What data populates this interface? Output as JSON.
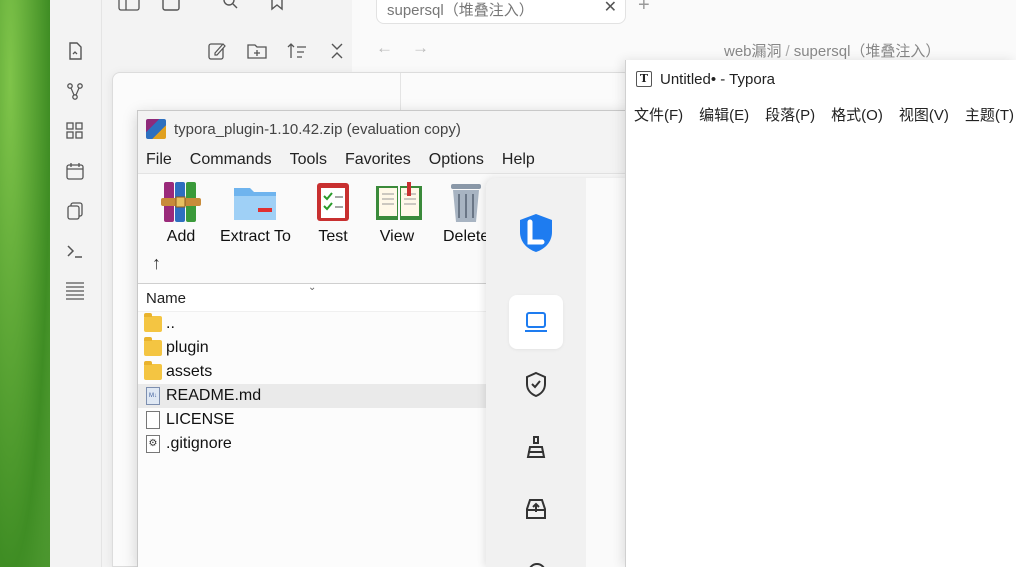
{
  "obsidian": {
    "tab_title": "supersql（堆叠注入）",
    "tab_close": "✕",
    "new_tab": "+",
    "nav_back": "←",
    "nav_forward": "→",
    "breadcrumb": [
      "web漏洞",
      "supersql（堆叠注入）"
    ],
    "breadcrumb_sep": "/"
  },
  "winrar": {
    "title": "typora_plugin-1.10.42.zip (evaluation copy)",
    "menu": [
      "File",
      "Commands",
      "Tools",
      "Favorites",
      "Options",
      "Help"
    ],
    "toolbar": [
      "Add",
      "Extract To",
      "Test",
      "View",
      "Delete"
    ],
    "up_arrow": "↑",
    "column_name": "Name",
    "files": [
      {
        "name": "..",
        "type": "folder"
      },
      {
        "name": "plugin",
        "type": "folder"
      },
      {
        "name": "assets",
        "type": "folder"
      },
      {
        "name": "README.md",
        "type": "md"
      },
      {
        "name": "LICENSE",
        "type": "file"
      },
      {
        "name": ".gitignore",
        "type": "config"
      }
    ]
  },
  "typora": {
    "title": "Untitled• - Typora",
    "icon_letter": "T",
    "menu": [
      "文件(F)",
      "编辑(E)",
      "段落(P)",
      "格式(O)",
      "视图(V)",
      "主题(T)"
    ]
  },
  "colors": {
    "accent_purple": "#8a5cf5",
    "security_blue": "#1e7cf0"
  }
}
